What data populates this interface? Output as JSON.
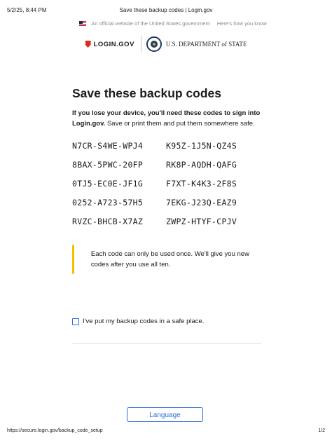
{
  "print_header": {
    "datetime": "5/2/25, 8:44 PM",
    "document_title": "Save these backup codes | Login.gov"
  },
  "gov_banner": {
    "official_text": "An official website of the United States government",
    "how_you_know": "Here's how you know",
    "icon": "us-flag-icon"
  },
  "logos": {
    "login_gov": "LOGIN.GOV",
    "state_dept": "U.S. DEPARTMENT of STATE",
    "login_icon": "shield-icon",
    "state_icon": "state-seal-icon"
  },
  "main": {
    "title": "Save these backup codes",
    "intro_bold": "If you lose your device, you'll need these codes to sign into Login.gov.",
    "intro_rest": " Save or print them and put them somewhere safe.",
    "codes": [
      "N7CR-S4WE-WPJ4",
      "K95Z-1J5N-QZ4S",
      "8BAX-5PWC-20FP",
      "RK8P-AQDH-QAFG",
      "0TJ5-EC0E-JF1G",
      "F7XT-K4K3-2F8S",
      "0252-A723-57H5",
      "7EKG-J23Q-EAZ9",
      "RVZC-BHCB-X7AZ",
      "ZWPZ-HTYF-CPJV"
    ],
    "alert_text": "Each code can only be used once. We'll give you new codes after you use all ten.",
    "checkbox_label": "I've put my backup codes in a safe place."
  },
  "footer_button": {
    "language_label": "Language"
  },
  "print_footer": {
    "url": "https://secure.login.gov/backup_code_setup",
    "page_count": "1/2"
  },
  "colors": {
    "accent_blue": "#2e6de0",
    "alert_yellow": "#f2c200",
    "login_red": "#d92d20"
  }
}
